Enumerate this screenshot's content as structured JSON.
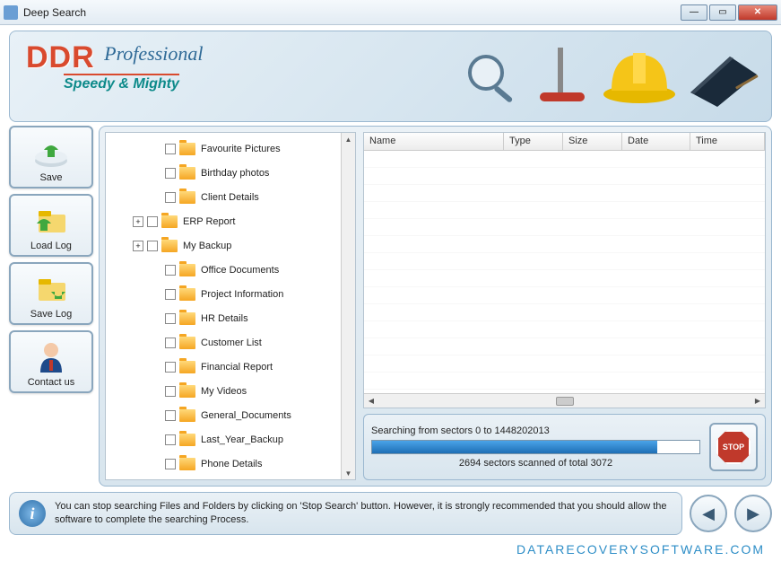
{
  "window": {
    "title": "Deep Search"
  },
  "brand": {
    "ddr": "DDR",
    "pro": "Professional",
    "tag": "Speedy & Mighty"
  },
  "sidebar": {
    "save": "Save",
    "loadlog": "Load Log",
    "savelog": "Save Log",
    "contact": "Contact us"
  },
  "tree": {
    "items": [
      {
        "label": "Favourite Pictures",
        "depth": 1,
        "expandable": false
      },
      {
        "label": "Birthday photos",
        "depth": 1,
        "expandable": false
      },
      {
        "label": "Client Details",
        "depth": 1,
        "expandable": false
      },
      {
        "label": "ERP Report",
        "depth": 0,
        "expandable": true
      },
      {
        "label": "My Backup",
        "depth": 0,
        "expandable": true
      },
      {
        "label": "Office Documents",
        "depth": 1,
        "expandable": false
      },
      {
        "label": "Project Information",
        "depth": 1,
        "expandable": false
      },
      {
        "label": "HR Details",
        "depth": 1,
        "expandable": false
      },
      {
        "label": "Customer List",
        "depth": 1,
        "expandable": false
      },
      {
        "label": "Financial Report",
        "depth": 1,
        "expandable": false
      },
      {
        "label": "My Videos",
        "depth": 1,
        "expandable": false
      },
      {
        "label": "General_Documents",
        "depth": 1,
        "expandable": false
      },
      {
        "label": "Last_Year_Backup",
        "depth": 1,
        "expandable": false
      },
      {
        "label": "Phone Details",
        "depth": 1,
        "expandable": false
      }
    ]
  },
  "columns": {
    "name": "Name",
    "type": "Type",
    "size": "Size",
    "date": "Date",
    "time": "Time"
  },
  "progress": {
    "status": "Searching from sectors  0 to  1448202013",
    "sub": "2694  sectors scanned of total 3072",
    "stop": "STOP"
  },
  "info": {
    "text": "You can stop searching Files and Folders by clicking on 'Stop Search' button. However, it is strongly recommended that you should allow the software to complete the searching Process."
  },
  "footer": {
    "url": "DATARECOVERYSOFTWARE.COM"
  }
}
